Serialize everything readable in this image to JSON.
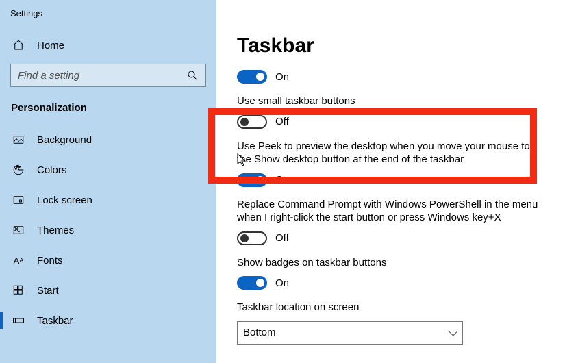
{
  "app": {
    "title": "Settings"
  },
  "sidebar": {
    "home_label": "Home",
    "search_placeholder": "Find a setting",
    "section_label": "Personalization",
    "items": [
      {
        "label": "Background"
      },
      {
        "label": "Colors"
      },
      {
        "label": "Lock screen"
      },
      {
        "label": "Themes"
      },
      {
        "label": "Fonts"
      },
      {
        "label": "Start"
      },
      {
        "label": "Taskbar"
      }
    ]
  },
  "main": {
    "title": "Taskbar",
    "settings": [
      {
        "text": "",
        "state": "on",
        "state_label": "On"
      },
      {
        "text": "Use small taskbar buttons",
        "state": "off",
        "state_label": "Off"
      },
      {
        "text": "Use Peek to preview the desktop when you move your mouse to the Show desktop button at the end of the taskbar",
        "state": "on",
        "state_label": "On"
      },
      {
        "text": "Replace Command Prompt with Windows PowerShell in the menu when I right-click the start button or press Windows key+X",
        "state": "off",
        "state_label": "Off"
      },
      {
        "text": "Show badges on taskbar buttons",
        "state": "on",
        "state_label": "On"
      }
    ],
    "location_label": "Taskbar location on screen",
    "location_value": "Bottom"
  }
}
